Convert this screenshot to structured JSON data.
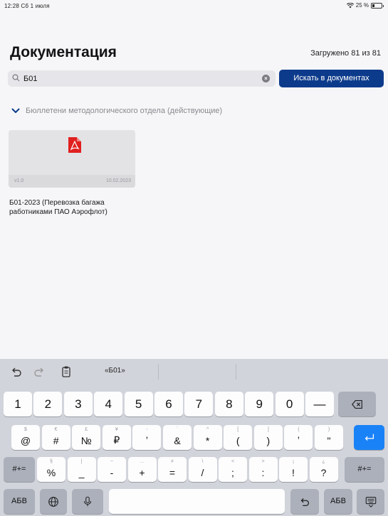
{
  "status_bar": {
    "time_date": "12:28  Сб 1 июля",
    "battery_text": "25 %",
    "battery_level": 0.25
  },
  "header": {
    "title": "Документация",
    "loaded_count": "Загружено 81 из 81"
  },
  "search": {
    "value": "Б01",
    "button_label": "Искать в документах"
  },
  "section": {
    "title": "Бюллетени методологического отдела (действующие)",
    "expanded": true
  },
  "documents": [
    {
      "version": "v1.0",
      "date": "10.02.2023",
      "title_line1": "Б01-2023 (Перевозка багажа",
      "title_line2": "работниками ПАО Аэрофлот)",
      "icon": "pdf-icon",
      "icon_color": "#e0201f"
    }
  ],
  "keyboard": {
    "suggestion": "«Б01»",
    "row1": [
      {
        "main": "1"
      },
      {
        "main": "2"
      },
      {
        "main": "3"
      },
      {
        "main": "4"
      },
      {
        "main": "5"
      },
      {
        "main": "6"
      },
      {
        "main": "7"
      },
      {
        "main": "8"
      },
      {
        "main": "9"
      },
      {
        "main": "0"
      },
      {
        "main": "—"
      }
    ],
    "row2": [
      {
        "main": "@",
        "alt": "$"
      },
      {
        "main": "#",
        "alt": "€"
      },
      {
        "main": "№",
        "alt": "£"
      },
      {
        "main": "₽",
        "alt": "¥"
      },
      {
        "main": "ʼ",
        "alt": "-"
      },
      {
        "main": "&",
        "alt": "`"
      },
      {
        "main": "*",
        "alt": "^"
      },
      {
        "main": "(",
        "alt": "["
      },
      {
        "main": ")",
        "alt": "]"
      },
      {
        "main": "ʼ",
        "alt": "("
      },
      {
        "main": "ʺ",
        "alt": ")"
      }
    ],
    "row3": [
      {
        "main": "%",
        "alt": "§"
      },
      {
        "main": "_",
        "alt": "|"
      },
      {
        "main": "-",
        "alt": "~"
      },
      {
        "main": "+",
        "alt": "…"
      },
      {
        "main": "=",
        "alt": "≠"
      },
      {
        "main": "/",
        "alt": "\\"
      },
      {
        "main": ";",
        "alt": "<"
      },
      {
        "main": ":",
        "alt": ">"
      },
      {
        "main": "!",
        "alt": "¡"
      },
      {
        "main": "?",
        "alt": "¿"
      }
    ],
    "symbols_left": "#+=",
    "symbols_right": "#+=",
    "abc_left": "АБВ",
    "abc_right": "АБВ",
    "accent_color": "#1a82f7"
  }
}
